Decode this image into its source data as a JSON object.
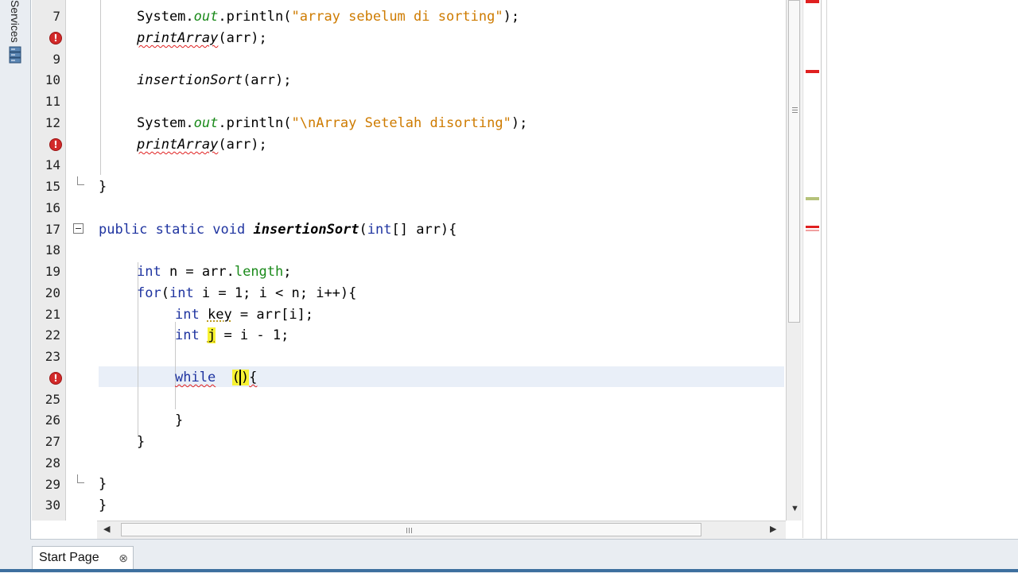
{
  "side": {
    "services_label": "Services"
  },
  "editor": {
    "lines": [
      {
        "no": "7",
        "error": false
      },
      {
        "no": "",
        "error": true
      },
      {
        "no": "9",
        "error": false
      },
      {
        "no": "10",
        "error": false
      },
      {
        "no": "11",
        "error": false
      },
      {
        "no": "12",
        "error": false
      },
      {
        "no": "",
        "error": true
      },
      {
        "no": "14",
        "error": false
      },
      {
        "no": "15",
        "error": false
      },
      {
        "no": "16",
        "error": false
      },
      {
        "no": "17",
        "error": false
      },
      {
        "no": "18",
        "error": false
      },
      {
        "no": "19",
        "error": false
      },
      {
        "no": "20",
        "error": false
      },
      {
        "no": "21",
        "error": false
      },
      {
        "no": "22",
        "error": false
      },
      {
        "no": "23",
        "error": false
      },
      {
        "no": "",
        "error": true
      },
      {
        "no": "25",
        "error": false
      },
      {
        "no": "26",
        "error": false
      },
      {
        "no": "27",
        "error": false
      },
      {
        "no": "28",
        "error": false
      },
      {
        "no": "29",
        "error": false
      },
      {
        "no": "30",
        "error": false
      }
    ],
    "error_glyph": "!",
    "code": {
      "l7_a": "System.",
      "l7_out": "out",
      "l7_b": ".println(",
      "l7_str": "\"array sebelum di sorting\"",
      "l7_c": ");",
      "l8_call": "printArray",
      "l8_rest": "(arr);",
      "l10_call": "insertionSort",
      "l10_rest": "(arr);",
      "l12_a": "System.",
      "l12_out": "out",
      "l12_b": ".println(",
      "l12_str": "\"\\nArray Setelah disorting\"",
      "l12_c": ");",
      "l13_call": "printArray",
      "l13_rest": "(arr);",
      "l15": "}",
      "l17_kw": "public static void",
      "l17_name": "insertionSort",
      "l17_paren": "(",
      "l17_type": "int",
      "l17_rest": "[] arr){",
      "l19_kw": "int",
      "l19_a": " n = arr.",
      "l19_fld": "length",
      "l19_b": ";",
      "l20_kw": "for",
      "l20_a": "(",
      "l20_kw2": "int",
      "l20_b": " i = 1; i < n; i++){",
      "l21_kw": "int",
      "l21_var": "key",
      "l21_rest": " = arr[i];",
      "l22_kw": "int",
      "l22_var": "j",
      "l22_rest": " = i - 1;",
      "l24_kw": "while",
      "l24_paren_open": "(",
      "l24_paren_close": ")",
      "l24_brace": "{",
      "l26": "}",
      "l27": "}",
      "l29": "}",
      "l30": "}"
    }
  },
  "bottom": {
    "tab_label": "Start Page",
    "tab_close": "⊗"
  },
  "colors": {
    "keyword": "#1f34a0",
    "string": "#ce7b00",
    "field": "#1a8a1a",
    "error": "#d22a2a",
    "current_line": "#e9eff8",
    "accent": "#3d6f9e"
  }
}
